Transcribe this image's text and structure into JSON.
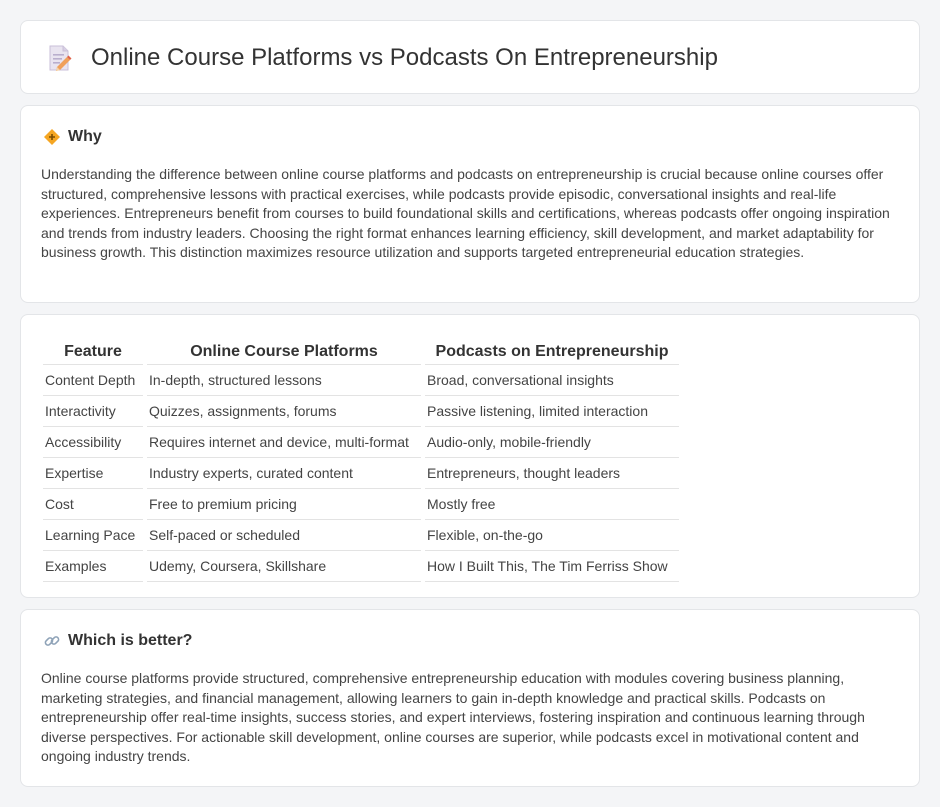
{
  "header": {
    "title": "Online Course Platforms vs Podcasts On Entrepreneurship",
    "icon": "document-pencil-icon"
  },
  "why": {
    "icon": "diamond-warning-icon",
    "title": "Why",
    "text": "Understanding the difference between online course platforms and podcasts on entrepreneurship is crucial because online courses offer structured, comprehensive lessons with practical exercises, while podcasts provide episodic, conversational insights and real-life experiences. Entrepreneurs benefit from courses to build foundational skills and certifications, whereas podcasts offer ongoing inspiration and trends from industry leaders. Choosing the right format enhances learning efficiency, skill development, and market adaptability for business growth. This distinction maximizes resource utilization and supports targeted entrepreneurial education strategies."
  },
  "table": {
    "headers": [
      "Feature",
      "Online Course Platforms",
      "Podcasts on Entrepreneurship"
    ],
    "rows": [
      [
        "Content Depth",
        "In-depth, structured lessons",
        "Broad, conversational insights"
      ],
      [
        "Interactivity",
        "Quizzes, assignments, forums",
        "Passive listening, limited interaction"
      ],
      [
        "Accessibility",
        "Requires internet and device, multi-format",
        "Audio-only, mobile-friendly"
      ],
      [
        "Expertise",
        "Industry experts, curated content",
        "Entrepreneurs, thought leaders"
      ],
      [
        "Cost",
        "Free to premium pricing",
        "Mostly free"
      ],
      [
        "Learning Pace",
        "Self-paced or scheduled",
        "Flexible, on-the-go"
      ],
      [
        "Examples",
        "Udemy, Coursera, Skillshare",
        "How I Built This, The Tim Ferriss Show"
      ]
    ]
  },
  "better": {
    "icon": "link-icon",
    "title": "Which is better?",
    "text": "Online course platforms provide structured, comprehensive entrepreneurship education with modules covering business planning, marketing strategies, and financial management, allowing learners to gain in-depth knowledge and practical skills. Podcasts on entrepreneurship offer real-time insights, success stories, and expert interviews, fostering inspiration and continuous learning through diverse perspectives. For actionable skill development, online courses are superior, while podcasts excel in motivational content and ongoing industry trends."
  }
}
